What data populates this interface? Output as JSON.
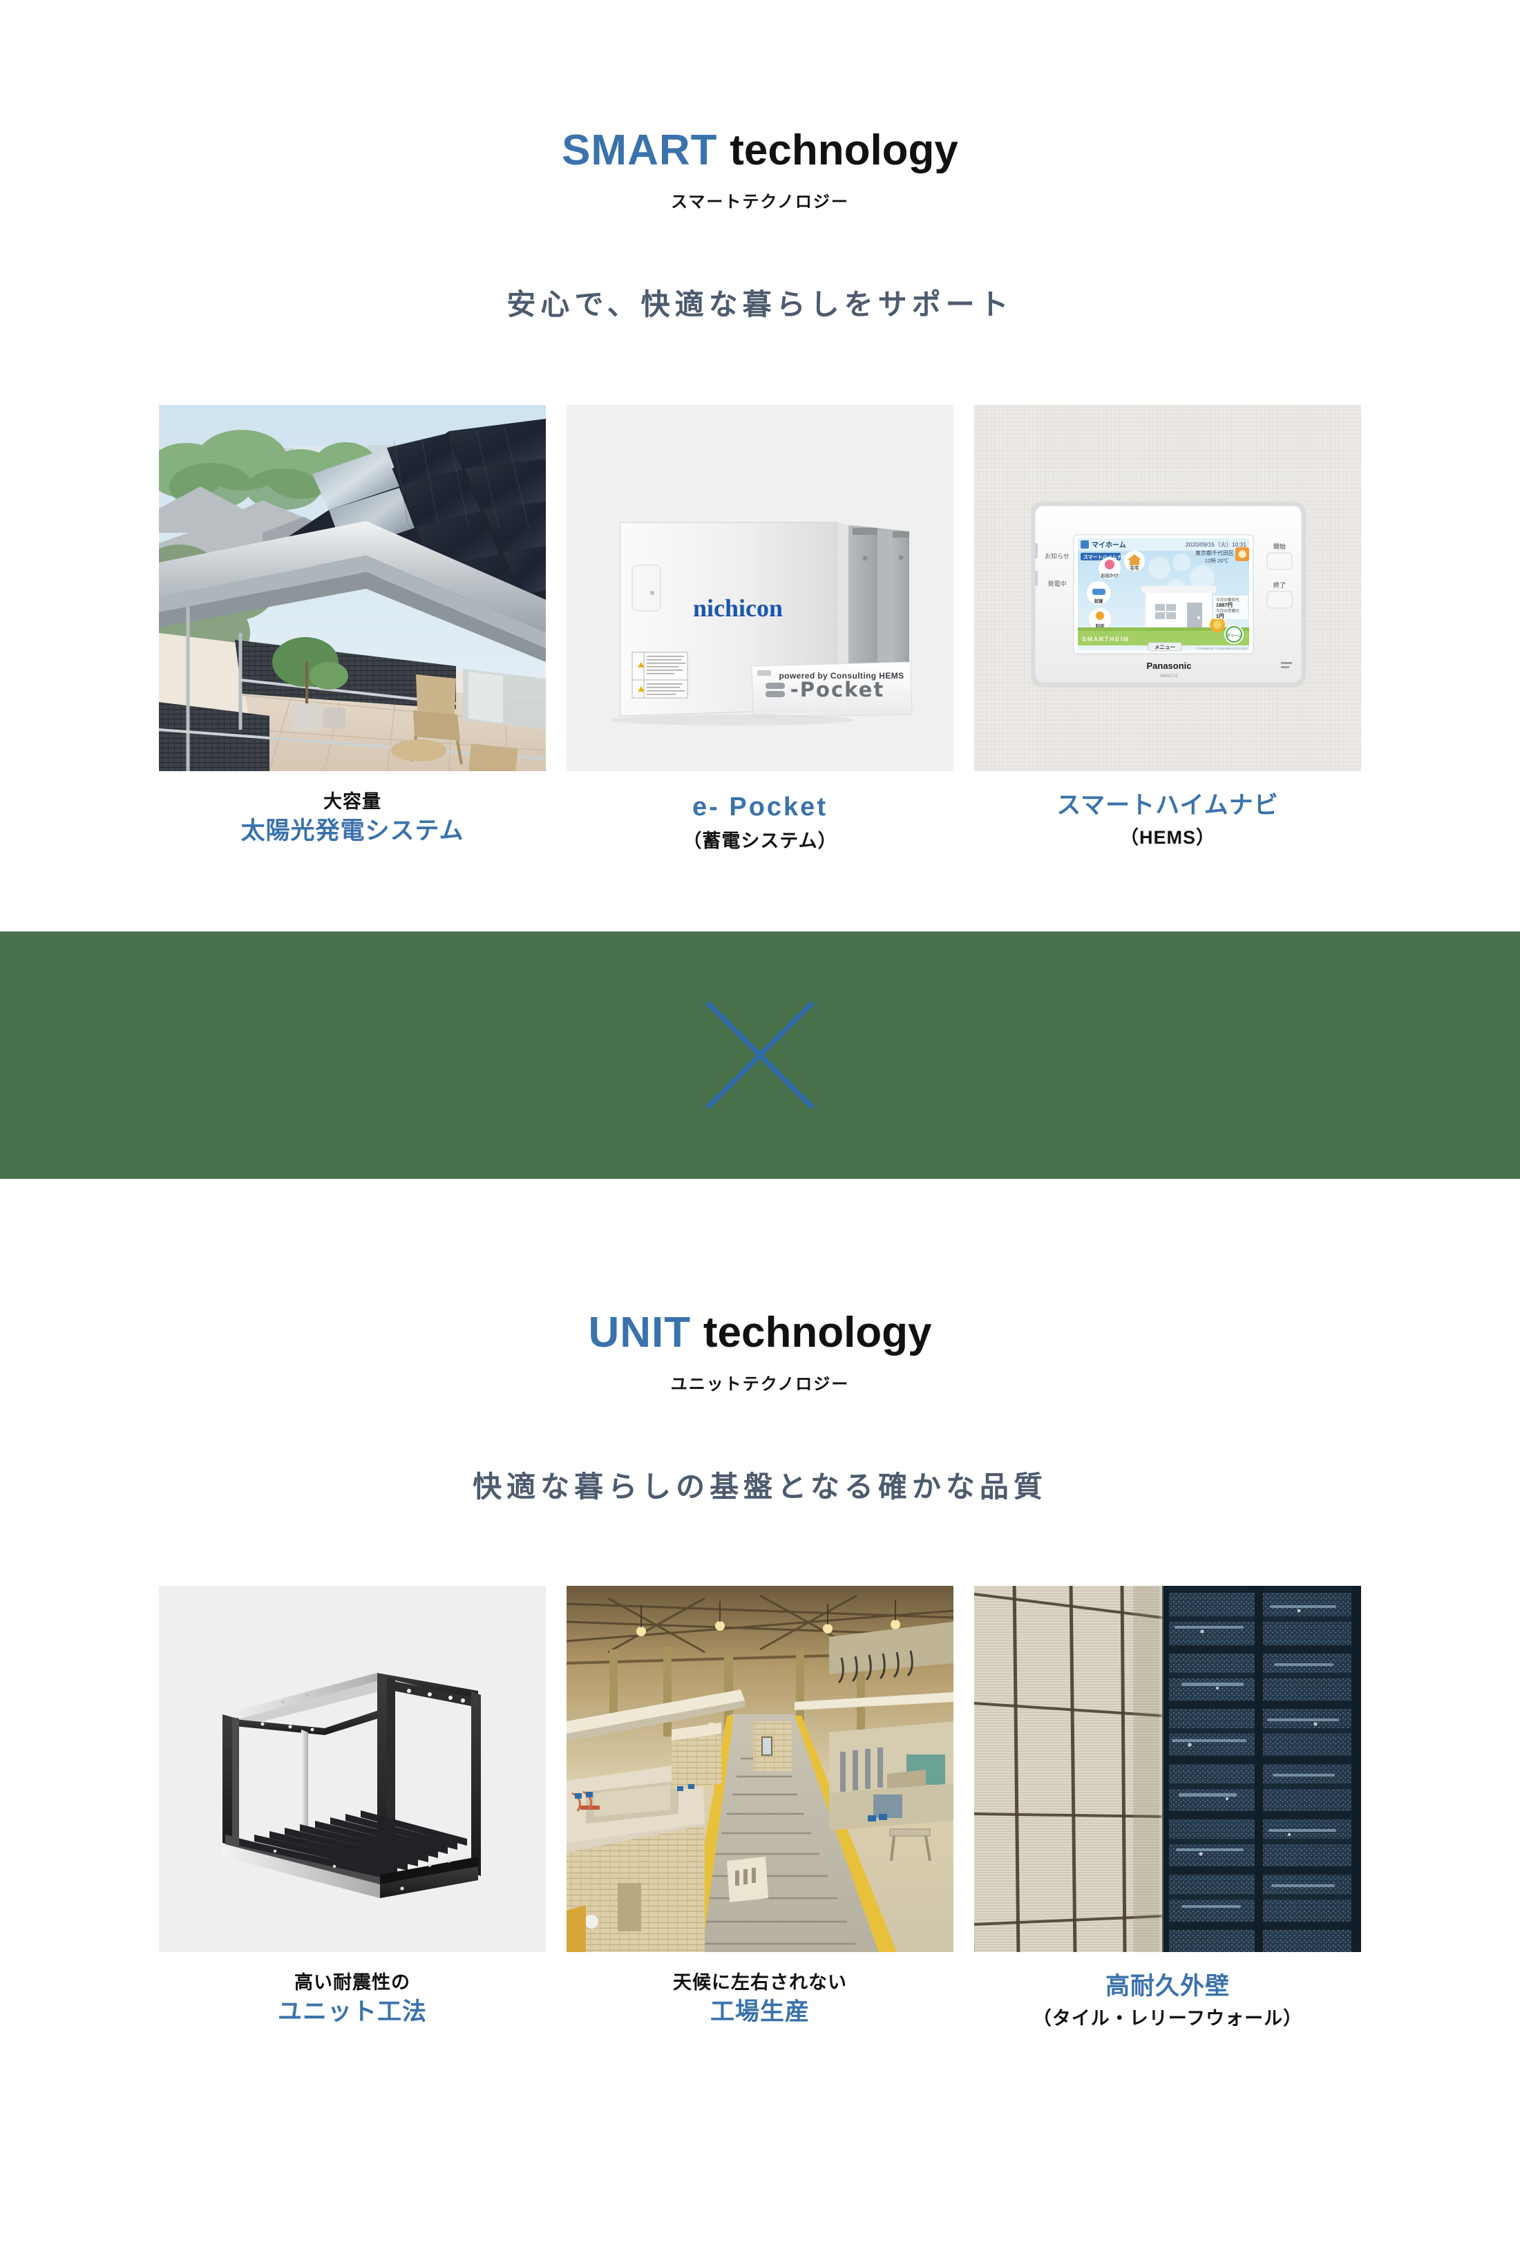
{
  "theme": {
    "accent_blue": "#3a72ac",
    "lead_slate": "#4d5b6e",
    "divider_green": "#49714c",
    "text_black": "#111111",
    "page_bg": "#ffffff"
  },
  "sections": [
    {
      "id": "smart",
      "title_accent": "SMART",
      "title_plain": "technology",
      "title_sub": "スマートテクノロジー",
      "lead": "安心で、快適な暮らしをサポート",
      "cards": [
        {
          "id": "solar",
          "image_name": "solar-panel-roof-photo",
          "line1": "大容量",
          "line2": "太陽光発電システム",
          "line2_style": "accent"
        },
        {
          "id": "epocket",
          "image_name": "nichicon-storage-battery-photo",
          "line1": "e- Pocket",
          "line1_style": "accent-en",
          "line2": "（蓄電システム）",
          "line2_style": "plain",
          "device_brand": "nichicon",
          "badge_title": "e-Pocket",
          "badge_sub": "powered by Consulting HEMS"
        },
        {
          "id": "hems",
          "image_name": "panasonic-hems-wall-panel-photo",
          "line1": "スマートハイムナビ",
          "line1_style": "accent",
          "line2": "（HEMS）",
          "line2_style": "plain",
          "panel_brand": "Panasonic",
          "panel_model": "MKN713",
          "panel_screen_title": "マイホーム",
          "panel_screen_datetime": "2020/09/15（火）10:31",
          "panel_screen_place": "東京都千代田区",
          "panel_screen_weather": "12時 20℃",
          "panel_screen_tag": "スマートハイムナビ",
          "panel_screen_menu": "メニュー",
          "panel_screen_buttons": [
            "お出かけ",
            "在宅",
            "就寝",
            "起床"
          ],
          "panel_screen_brandmark": "SMARTHEIM",
          "panel_screen_meter": "グリーンメーター",
          "panel_screen_stat1_label": "今月の電気代",
          "panel_screen_stat1_value": "1887円",
          "panel_screen_stat2_label": "今月の売電代",
          "panel_screen_stat2_value": "1円",
          "side_labels": [
            "お知らせ",
            "発電中"
          ],
          "right_buttons": [
            "開始",
            "終了"
          ]
        }
      ]
    },
    {
      "id": "unit",
      "title_accent": "UNIT",
      "title_plain": "technology",
      "title_sub": "ユニットテクノロジー",
      "lead": "快適な暮らしの基盤となる確かな品質",
      "cards": [
        {
          "id": "unit-method",
          "image_name": "steel-box-frame-unit-photo",
          "line1": "高い耐震性の",
          "line2": "ユニット工法",
          "line2_style": "accent"
        },
        {
          "id": "factory",
          "image_name": "factory-production-line-photo",
          "line1": "天候に左右されない",
          "line2": "工場生産",
          "line2_style": "accent"
        },
        {
          "id": "wall",
          "image_name": "exterior-tile-wall-photo",
          "line1": "高耐久外壁",
          "line1_style": "accent",
          "line2": "（タイル・レリーフウォール）",
          "line2_style": "plain"
        }
      ]
    }
  ],
  "divider": {
    "icon_name": "cross-multiply-icon",
    "icon_color": "#2f6bad",
    "background": "#49714c"
  }
}
